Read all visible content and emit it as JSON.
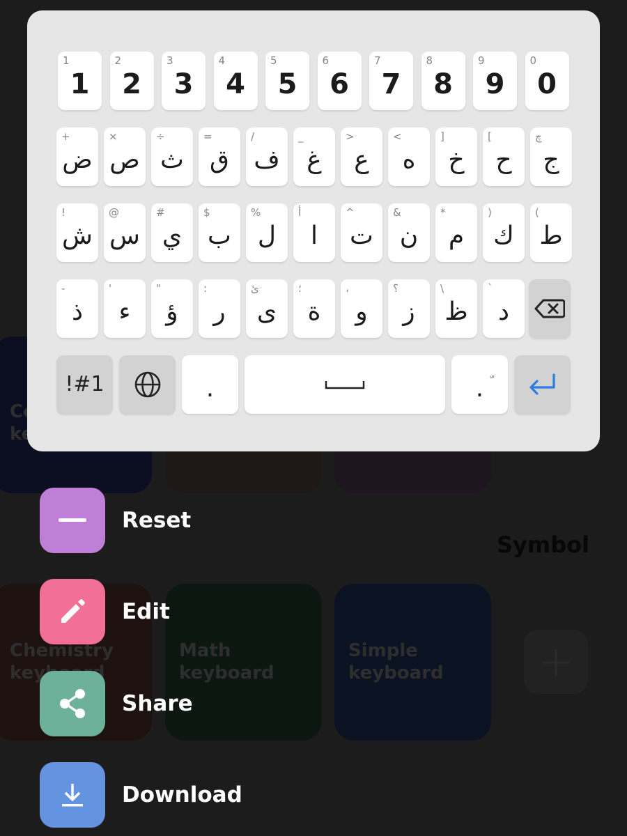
{
  "colors": {
    "background": "#1c1c1c",
    "panel": "#e6e6e6",
    "reset": "#c07fd6",
    "edit": "#f27097",
    "share": "#6eb19a",
    "download": "#6494e0",
    "enter_accent": "#2a7de1"
  },
  "background": {
    "tiles": [
      {
        "title": "Co\nke"
      },
      {
        "title": ""
      },
      {
        "title": ""
      },
      {
        "title": "Chemistry\nkeyboard"
      },
      {
        "title": "Math\nkeyboard"
      },
      {
        "title": "Simple\nkeyboard"
      }
    ],
    "section_label": "Symbol",
    "add_icon": "plus-icon",
    "add_glyph": "+"
  },
  "keyboard": {
    "rows": [
      [
        {
          "main": "1",
          "sub": "1"
        },
        {
          "main": "2",
          "sub": "2"
        },
        {
          "main": "3",
          "sub": "3"
        },
        {
          "main": "4",
          "sub": "4"
        },
        {
          "main": "5",
          "sub": "5"
        },
        {
          "main": "6",
          "sub": "6"
        },
        {
          "main": "7",
          "sub": "7"
        },
        {
          "main": "8",
          "sub": "8"
        },
        {
          "main": "9",
          "sub": "9"
        },
        {
          "main": "0",
          "sub": "0"
        }
      ],
      [
        {
          "main": "ض",
          "sub": "+"
        },
        {
          "main": "ص",
          "sub": "×"
        },
        {
          "main": "ث",
          "sub": "÷"
        },
        {
          "main": "ق",
          "sub": "="
        },
        {
          "main": "ف",
          "sub": "/"
        },
        {
          "main": "غ",
          "sub": "_"
        },
        {
          "main": "ع",
          "sub": ">"
        },
        {
          "main": "ه",
          "sub": "<"
        },
        {
          "main": "خ",
          "sub": "]"
        },
        {
          "main": "ح",
          "sub": "["
        },
        {
          "main": "ج",
          "sub": "چ"
        }
      ],
      [
        {
          "main": "ش",
          "sub": "!"
        },
        {
          "main": "س",
          "sub": "@"
        },
        {
          "main": "ي",
          "sub": "#"
        },
        {
          "main": "ب",
          "sub": "$"
        },
        {
          "main": "ل",
          "sub": "%"
        },
        {
          "main": "ا",
          "sub": "أ"
        },
        {
          "main": "ت",
          "sub": "^"
        },
        {
          "main": "ن",
          "sub": "&"
        },
        {
          "main": "م",
          "sub": "*"
        },
        {
          "main": "ك",
          "sub": ")"
        },
        {
          "main": "ط",
          "sub": "("
        }
      ],
      [
        {
          "main": "ذ",
          "sub": "-"
        },
        {
          "main": "ء",
          "sub": "'"
        },
        {
          "main": "ؤ",
          "sub": "\""
        },
        {
          "main": "ر",
          "sub": ":"
        },
        {
          "main": "ى",
          "sub": "ئ"
        },
        {
          "main": "ة",
          "sub": "؛"
        },
        {
          "main": "و",
          "sub": "،"
        },
        {
          "main": "ز",
          "sub": "؟"
        },
        {
          "main": "ظ",
          "sub": "\\"
        },
        {
          "main": "د",
          "sub": "`"
        }
      ]
    ],
    "backspace_icon": "backspace-icon",
    "symbols_label": "!#1",
    "globe_icon": "globe-icon",
    "period_label": ".",
    "space_icon": "space-icon",
    "period2_label": ".",
    "period2_sub": "ّ",
    "enter_icon": "enter-icon"
  },
  "menu": [
    {
      "label": "Reset",
      "icon": "minus-icon"
    },
    {
      "label": "Edit",
      "icon": "pencil-icon"
    },
    {
      "label": "Share",
      "icon": "share-icon"
    },
    {
      "label": "Download",
      "icon": "download-icon"
    }
  ]
}
